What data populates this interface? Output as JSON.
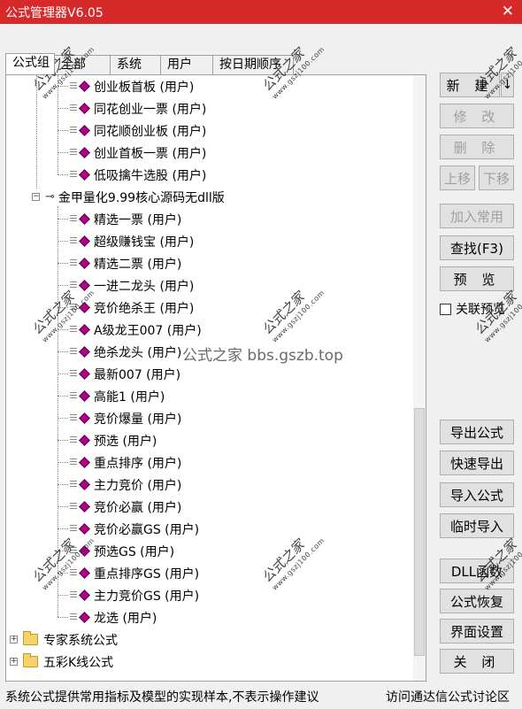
{
  "window": {
    "title": "公式管理器V6.05",
    "close_glyph": "✕"
  },
  "tabs": [
    {
      "label": "公式组"
    },
    {
      "label": "全部"
    },
    {
      "label": "系统"
    },
    {
      "label": "用户"
    },
    {
      "label": "按日期顺序"
    }
  ],
  "tree": {
    "items": [
      {
        "label": "创业板首板  (用户)"
      },
      {
        "label": "同花创业一票  (用户)"
      },
      {
        "label": "同花顺创业板  (用户)"
      },
      {
        "label": "创业首板一票  (用户)"
      },
      {
        "label": "低吸擒牛选股  (用户)"
      },
      {
        "label": "金甲量化9.99核心源码无dll版"
      },
      {
        "label": "精选一票  (用户)"
      },
      {
        "label": "超级赚钱宝  (用户)"
      },
      {
        "label": "精选二票  (用户)"
      },
      {
        "label": "一进二龙头  (用户)"
      },
      {
        "label": "竞价绝杀王  (用户)"
      },
      {
        "label": "A级龙王007  (用户)"
      },
      {
        "label": "绝杀龙头  (用户)"
      },
      {
        "label": "最新007  (用户)"
      },
      {
        "label": "高能1  (用户)"
      },
      {
        "label": "竞价爆量  (用户)"
      },
      {
        "label": "预选  (用户)"
      },
      {
        "label": "重点排序  (用户)"
      },
      {
        "label": "主力竞价  (用户)"
      },
      {
        "label": "竞价必赢  (用户)"
      },
      {
        "label": "竞价必赢GS  (用户)"
      },
      {
        "label": "预选GS  (用户)"
      },
      {
        "label": "重点排序GS  (用户)"
      },
      {
        "label": "主力竞价GS  (用户)"
      },
      {
        "label": "龙选  (用户)"
      },
      {
        "label": "专家系统公式"
      },
      {
        "label": "五彩K线公式"
      }
    ]
  },
  "buttons": {
    "new": "新 建",
    "new_arrow": "↓",
    "modify": "修 改",
    "delete": "删 除",
    "move_up": "上移",
    "move_down": "下移",
    "add_common": "加入常用",
    "find": "查找(F3)",
    "preview": "预 览",
    "export": "导出公式",
    "quick_export": "快速导出",
    "import": "导入公式",
    "temp_import": "临时导入",
    "dll": "DLL函数",
    "restore": "公式恢复",
    "ui_settings": "界面设置",
    "close": "关 闭"
  },
  "options": {
    "link_preview": "关联预览"
  },
  "status": {
    "left": "系统公式提供常用指标及模型的实现样本,不表示操作建议",
    "right": "访问通达信公式讨论区"
  },
  "watermark": {
    "text": "公式之家",
    "url": "www.gszj100.com",
    "center": "公式之家 bbs.gszb.top"
  }
}
